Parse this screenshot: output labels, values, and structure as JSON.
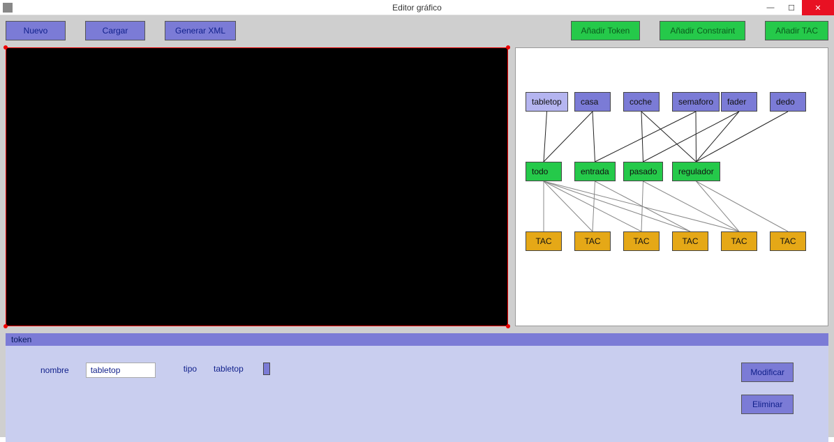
{
  "window": {
    "title": "Editor gráfico"
  },
  "toolbar": {
    "left": {
      "nuevo": "Nuevo",
      "cargar": "Cargar",
      "generar_xml": "Generar XML"
    },
    "right": {
      "add_token": "Añadir Token",
      "add_constraint": "Añadir Constraint",
      "add_tac": "Añadir TAC"
    }
  },
  "graph": {
    "tokens": [
      {
        "id": "tabletop",
        "label": "tabletop",
        "selected": true
      },
      {
        "id": "casa",
        "label": "casa"
      },
      {
        "id": "coche",
        "label": "coche"
      },
      {
        "id": "semaforo",
        "label": "semaforo"
      },
      {
        "id": "fader",
        "label": "fader"
      },
      {
        "id": "dedo",
        "label": "dedo"
      }
    ],
    "constraints": [
      {
        "id": "todo",
        "label": "todo"
      },
      {
        "id": "entrada",
        "label": "entrada"
      },
      {
        "id": "pasado",
        "label": "pasado"
      },
      {
        "id": "regulador",
        "label": "regulador"
      }
    ],
    "tacs": [
      {
        "id": "tac1",
        "label": "TAC"
      },
      {
        "id": "tac2",
        "label": "TAC"
      },
      {
        "id": "tac3",
        "label": "TAC"
      },
      {
        "id": "tac4",
        "label": "TAC"
      },
      {
        "id": "tac5",
        "label": "TAC"
      },
      {
        "id": "tac6",
        "label": "TAC"
      }
    ],
    "edges_token_constraint": [
      [
        "tabletop",
        "todo"
      ],
      [
        "casa",
        "todo"
      ],
      [
        "casa",
        "entrada"
      ],
      [
        "coche",
        "pasado"
      ],
      [
        "coche",
        "regulador"
      ],
      [
        "semaforo",
        "entrada"
      ],
      [
        "semaforo",
        "regulador"
      ],
      [
        "fader",
        "pasado"
      ],
      [
        "fader",
        "regulador"
      ],
      [
        "dedo",
        "regulador"
      ]
    ],
    "edges_constraint_tac": [
      [
        "todo",
        "tac1"
      ],
      [
        "todo",
        "tac2"
      ],
      [
        "todo",
        "tac3"
      ],
      [
        "todo",
        "tac4"
      ],
      [
        "todo",
        "tac5"
      ],
      [
        "entrada",
        "tac2"
      ],
      [
        "entrada",
        "tac4"
      ],
      [
        "pasado",
        "tac3"
      ],
      [
        "pasado",
        "tac5"
      ],
      [
        "regulador",
        "tac5"
      ],
      [
        "regulador",
        "tac6"
      ]
    ]
  },
  "form": {
    "section_title": "token",
    "nombre_label": "nombre",
    "nombre_value": "tabletop",
    "tipo_label": "tipo",
    "tipo_value": "tabletop",
    "modificar": "Modificar",
    "eliminar": "Eliminar"
  }
}
